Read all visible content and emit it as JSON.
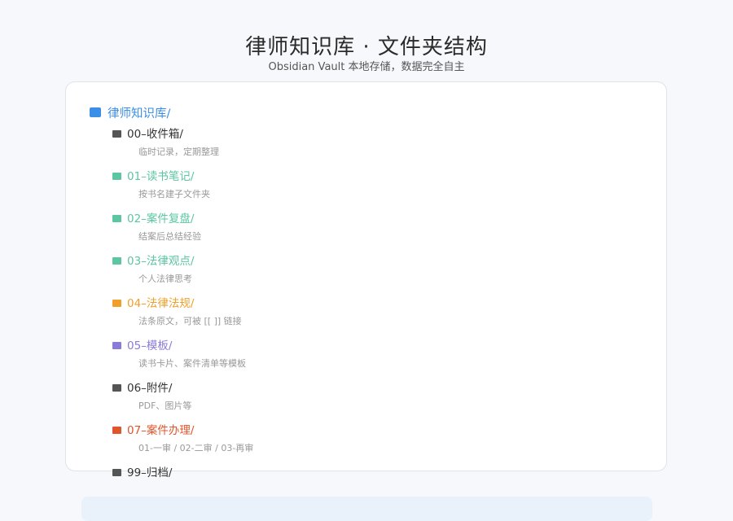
{
  "header": {
    "title": "律师知识库 · 文件夹结构",
    "subtitle": "Obsidian Vault 本地存储，数据完全自主"
  },
  "tree": {
    "root": {
      "label": "律师知识库/",
      "color": "#3a8ee6"
    },
    "children": [
      {
        "label": "00–收件箱/",
        "desc": "临时记录，定期整理",
        "color": "#555555"
      },
      {
        "label": "01–读书笔记/",
        "desc": "按书名建子文件夹",
        "color": "#5cc6a0"
      },
      {
        "label": "02–案件复盘/",
        "desc": "结案后总结经验",
        "color": "#5cc6a0"
      },
      {
        "label": "03–法律观点/",
        "desc": "个人法律思考",
        "color": "#5cc6a0"
      },
      {
        "label": "04–法律法规/",
        "desc": "法条原文，可被 [[ ]] 链接",
        "color": "#f0a02a"
      },
      {
        "label": "05–模板/",
        "desc": "读书卡片、案件清单等模板",
        "color": "#8a7bd8"
      },
      {
        "label": "06–附件/",
        "desc": "PDF、图片等",
        "color": "#555555"
      },
      {
        "label": "07–案件办理/",
        "desc": "01-一审 / 02-二审 / 03-再审",
        "color": "#e0552b"
      },
      {
        "label": "99–归档/",
        "desc": "",
        "color": "#555555"
      }
    ]
  }
}
